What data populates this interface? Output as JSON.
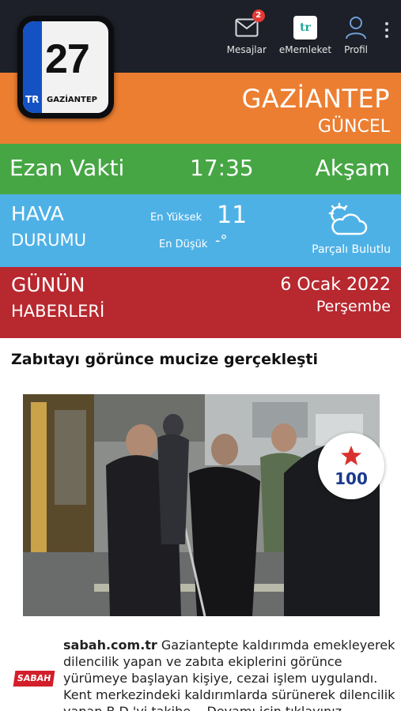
{
  "plate": {
    "country": "TR",
    "number": "27",
    "city": "GAZİANTEP"
  },
  "nav": {
    "messages_label": "Mesajlar",
    "messages_badge": "2",
    "ememleket_label": "eMemleket",
    "ememleket_logo": "tr",
    "profile_label": "Profil"
  },
  "city": {
    "title": "GAZİANTEP",
    "subtitle": "GÜNCEL"
  },
  "prayer": {
    "label": "Ezan Vakti",
    "time": "17:35",
    "name": "Akşam"
  },
  "weather": {
    "title_line1": "HAVA",
    "title_line2": "DURUMU",
    "high_label": "En Yüksek",
    "high_value": "11",
    "low_label": "En Düşük",
    "low_value": "-°",
    "condition": "Parçalı Bulutlu",
    "icon": "partly-cloudy-icon"
  },
  "news_header": {
    "line1": "GÜNÜN",
    "line2": "HABERLERİ",
    "date": "6 Ocak 2022",
    "day": "Perşembe"
  },
  "article": {
    "headline": "Zabıtayı görünce mucize gerçekleşti",
    "score": "100",
    "source_logo": "SABAH",
    "source": "sabah.com.tr",
    "summary": "Gaziantepte kaldırımda emekleyerek dilencilik yapan ve zabıta ekiplerini görünce yürümeye başlayan kişiye, cezai işlem uygulandı. Kent merkezindeki kaldırımlarda sürünerek dilencilik yapan B.D.'yi takibe... Devamı için tıklayınız"
  },
  "colors": {
    "topbar": "#1d2028",
    "orange": "#ec7e31",
    "green": "#46a644",
    "blue": "#4eb1e6",
    "red": "#b8282f",
    "plate_blue": "#1452c4"
  }
}
